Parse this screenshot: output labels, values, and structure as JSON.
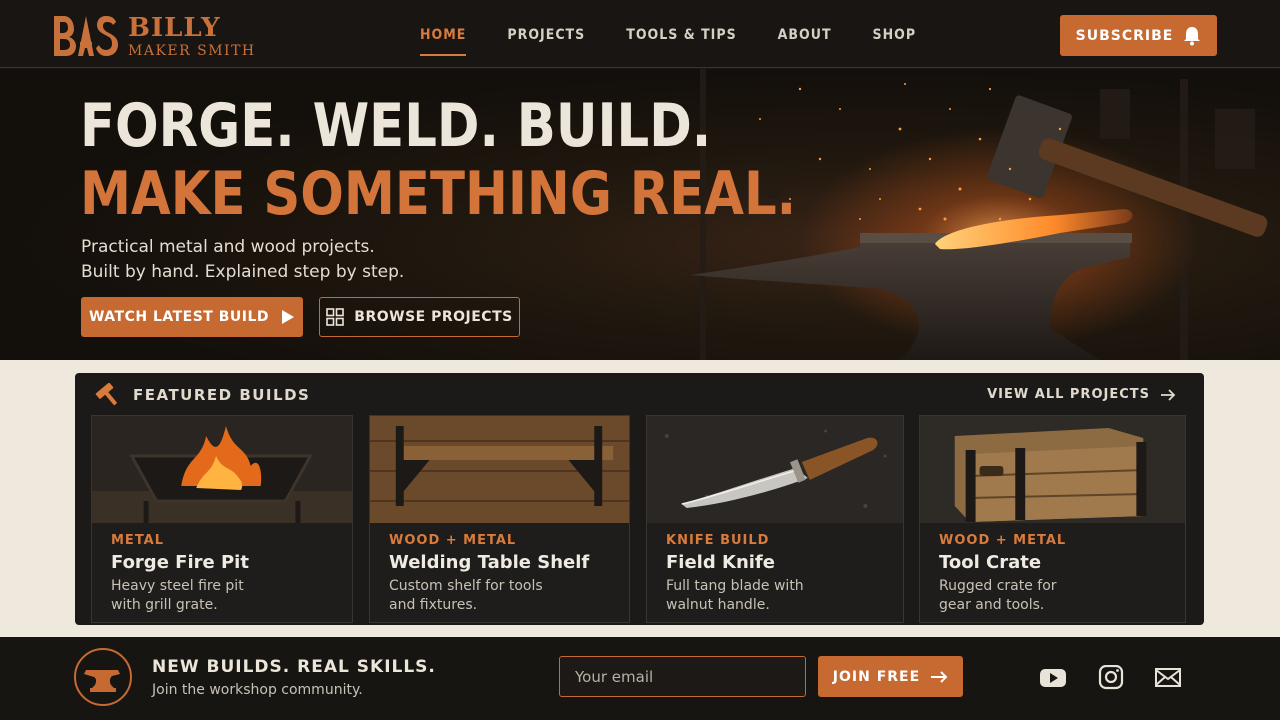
{
  "brand": {
    "mark": "BAS",
    "name": "BILLY",
    "subtitle": "MAKER SMITH"
  },
  "nav": {
    "items": [
      {
        "label": "HOME",
        "active": true
      },
      {
        "label": "PROJECTS",
        "active": false
      },
      {
        "label": "TOOLS & TIPS",
        "active": false
      },
      {
        "label": "ABOUT",
        "active": false
      },
      {
        "label": "SHOP",
        "active": false
      }
    ],
    "subscribe_label": "SUBSCRIBE"
  },
  "hero": {
    "headline_1": "FORGE. WELD. BUILD.",
    "headline_2": "MAKE SOMETHING REAL.",
    "tagline_1": "Practical metal and wood projects.",
    "tagline_2": "Built by hand. Explained step by step.",
    "primary_cta": "WATCH LATEST BUILD",
    "secondary_cta": "BROWSE PROJECTS"
  },
  "featured": {
    "title": "FEATURED BUILDS",
    "view_all": "VIEW ALL PROJECTS",
    "cards": [
      {
        "category": "METAL",
        "title": "Forge Fire Pit",
        "desc_1": "Heavy steel fire pit",
        "desc_2": "with grill grate."
      },
      {
        "category": "WOOD + METAL",
        "title": "Welding Table Shelf",
        "desc_1": "Custom shelf for tools",
        "desc_2": "and fixtures."
      },
      {
        "category": "KNIFE BUILD",
        "title": "Field Knife",
        "desc_1": "Full tang blade with",
        "desc_2": "walnut handle."
      },
      {
        "category": "WOOD + METAL",
        "title": "Tool Crate",
        "desc_1": "Rugged crate for",
        "desc_2": "gear and tools."
      }
    ]
  },
  "footer": {
    "title": "NEW BUILDS. REAL SKILLS.",
    "subtitle": "Join the workshop community.",
    "email_placeholder": "Your email",
    "join_label": "JOIN FREE",
    "social": [
      "youtube-icon",
      "instagram-icon",
      "email-icon"
    ]
  },
  "colors": {
    "accent": "#c66a32",
    "accent_text": "#d97b3c",
    "dark": "#181512",
    "cream": "#efe8dc"
  }
}
